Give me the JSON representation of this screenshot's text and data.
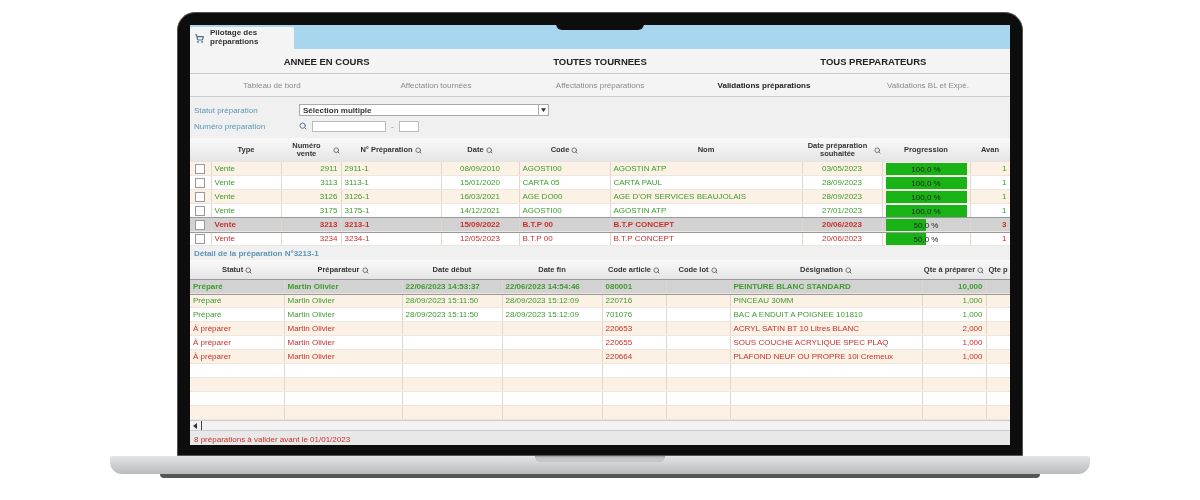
{
  "window": {
    "tab": "Pilotage des préparations"
  },
  "scopes": [
    {
      "label": "ANNEE EN COURS"
    },
    {
      "label": "TOUTES TOURNEES"
    },
    {
      "label": "TOUS PREPARATEURS"
    }
  ],
  "nav_tabs": [
    {
      "label": "Tableau de bord",
      "selected": false
    },
    {
      "label": "Affectation tournées",
      "selected": false
    },
    {
      "label": "Affectations préparations",
      "selected": false
    },
    {
      "label": "Validations préparations",
      "selected": true
    },
    {
      "label": "Validations BL et Expé.",
      "selected": false
    }
  ],
  "filters": {
    "status_label": "Statut préparation",
    "status_value": "Sélection multiple",
    "number_label": "Numéro préparation",
    "range_separator": "-"
  },
  "preparations": {
    "columns": [
      {
        "label": "Type",
        "searchable": false
      },
      {
        "label": "Numéro vente",
        "searchable": true
      },
      {
        "label": "N° Préparation",
        "searchable": true
      },
      {
        "label": "Date",
        "searchable": true
      },
      {
        "label": "Code",
        "searchable": true
      },
      {
        "label": "Nom",
        "searchable": false
      },
      {
        "label": "Date préparation souhaitée",
        "searchable": true
      },
      {
        "label": "Progression",
        "searchable": false
      },
      {
        "label": "Avan",
        "searchable": false
      }
    ],
    "rows": [
      {
        "type": "Vente",
        "sale_no": "2911",
        "prep_no": "2911-1",
        "date": "08/09/2010",
        "code": "AGOSTI00",
        "name": "AGOSTIN ATP",
        "due_date": "03/05/2023",
        "progress": "100,0 %",
        "level": 1,
        "advance": "1",
        "kind": "prepared",
        "selected": false,
        "checked": false
      },
      {
        "type": "Vente",
        "sale_no": "3113",
        "prep_no": "3113-1",
        "date": "15/01/2020",
        "code": "CARTA 05",
        "name": "CARTA PAUL",
        "due_date": "28/09/2023",
        "progress": "100,0 %",
        "level": 1,
        "advance": "1",
        "kind": "prepared",
        "selected": false,
        "checked": false
      },
      {
        "type": "Vente",
        "sale_no": "3126",
        "prep_no": "3126-1",
        "date": "16/03/2021",
        "code": "AGE DO00",
        "name": "AGE D'OR SERVICES BEAUJOLAIS",
        "due_date": "28/09/2023",
        "progress": "100,0 %",
        "level": 1,
        "advance": "1",
        "kind": "prepared",
        "selected": false,
        "checked": false
      },
      {
        "type": "Vente",
        "sale_no": "3175",
        "prep_no": "3175-1",
        "date": "14/12/2021",
        "code": "AGOSTI00",
        "name": "AGOSTIN ATP",
        "due_date": "27/01/2023",
        "progress": "100,0 %",
        "level": 1,
        "advance": "1",
        "kind": "prepared",
        "selected": false,
        "checked": false
      },
      {
        "type": "Vente",
        "sale_no": "3213",
        "prep_no": "3213-1",
        "date": "15/09/2022",
        "code": "B.T.P 00",
        "name": "B.T.P CONCEPT",
        "due_date": "20/06/2023",
        "progress": "50,0 %",
        "level": 0.5,
        "advance": "3",
        "kind": "pending",
        "selected": true,
        "checked": false
      },
      {
        "type": "Vente",
        "sale_no": "3234",
        "prep_no": "3234-1",
        "date": "12/05/2023",
        "code": "B.T.P 00",
        "name": "B.T.P CONCEPT",
        "due_date": "20/06/2023",
        "progress": "50,0 %",
        "level": 0.5,
        "advance": "1",
        "kind": "pending",
        "selected": false,
        "checked": false
      }
    ]
  },
  "detail": {
    "title": "Détail de la préparation N°3213-1",
    "columns": [
      {
        "label": "Statut",
        "searchable": true
      },
      {
        "label": "Préparateur",
        "searchable": true
      },
      {
        "label": "Date début",
        "searchable": false
      },
      {
        "label": "Date fin",
        "searchable": false
      },
      {
        "label": "Code article",
        "searchable": true
      },
      {
        "label": "Code lot",
        "searchable": true
      },
      {
        "label": "Désignation",
        "searchable": true
      },
      {
        "label": "Qte à préparer",
        "searchable": true
      },
      {
        "label": "Qte p",
        "searchable": false
      }
    ],
    "rows": [
      {
        "status": "Préparé",
        "preparer": "Martin Olivier",
        "start": "22/06/2023 14:53:37",
        "end": "22/06/2023 14:54:46",
        "article": "080001",
        "designation": "PEINTURE BLANC STANDARD",
        "quantity": "10,000",
        "kind": "prepared",
        "selected": true
      },
      {
        "status": "Préparé",
        "preparer": "Martin Olivier",
        "start": "28/09/2023 15:11:50",
        "end": "28/09/2023 15:12:09",
        "article": "220716",
        "designation": "PINCEAU 30MM",
        "quantity": "1,000",
        "kind": "prepared",
        "selected": false
      },
      {
        "status": "Préparé",
        "preparer": "Martin Olivier",
        "start": "28/09/2023 15:11:50",
        "end": "28/09/2023 15:12:09",
        "article": "701076",
        "designation": "BAC A ENDUIT A POIGNEE 101810",
        "quantity": "1,000",
        "kind": "prepared",
        "selected": false
      },
      {
        "status": "À préparer",
        "preparer": "Martin Olivier",
        "article": "220653",
        "designation": "ACRYL SATIN BT 10 Litres BLANC",
        "quantity": "2,000",
        "kind": "pending",
        "selected": false
      },
      {
        "status": "À préparer",
        "preparer": "Martin Olivier",
        "article": "220655",
        "designation": "SOUS COUCHE ACRYLIQUE SPEC PLAQ",
        "quantity": "1,000",
        "kind": "pending",
        "selected": false
      },
      {
        "status": "À préparer",
        "preparer": "Martin Olivier",
        "article": "220664",
        "designation": "PLAFOND NEUF OU PROPRE 10l Cremeux",
        "quantity": "1,000",
        "kind": "pending",
        "selected": false
      }
    ]
  },
  "footer": "8 préparations à valider avant le 01/01/2023"
}
